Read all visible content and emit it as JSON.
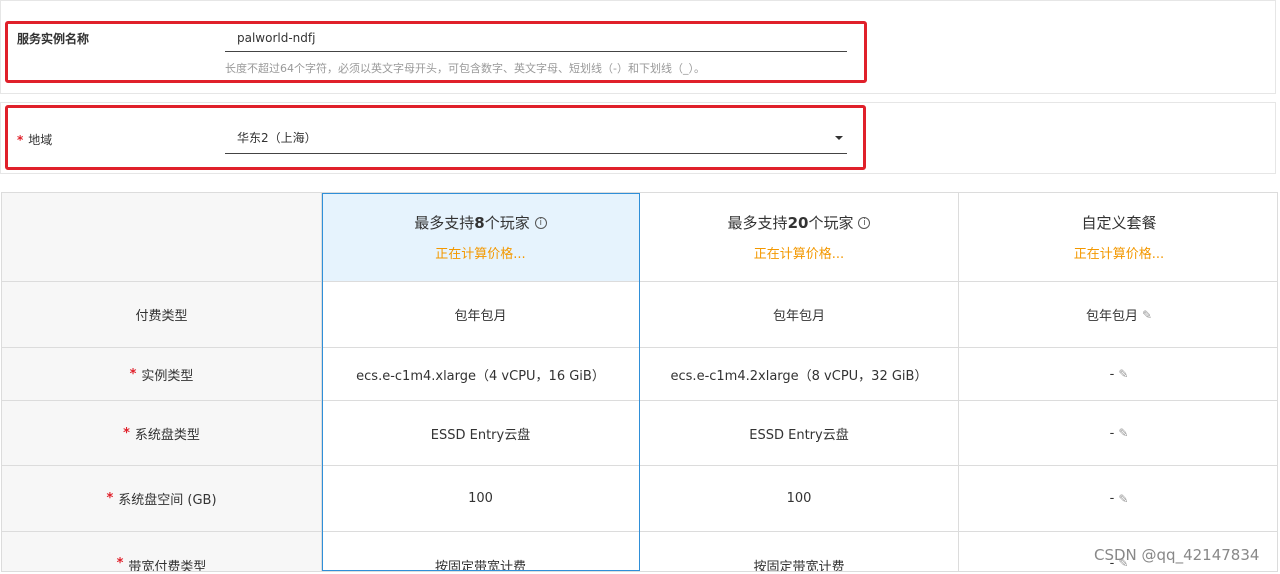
{
  "form": {
    "instance_name_label": "服务实例名称",
    "instance_name_value": "palworld-ndfj",
    "instance_name_hint": "长度不超过64个字符，必须以英文字母开头，可包含数字、英文字母、短划线（-）和下划线（_）。",
    "region_required": "*",
    "region_label": "地域",
    "region_value": "华东2（上海）"
  },
  "plans": [
    {
      "title_prefix": "最多支持",
      "title_number": "8",
      "title_suffix": "个玩家",
      "price": "正在计算价格...",
      "info_icon": "i"
    },
    {
      "title_prefix": "最多支持",
      "title_number": "20",
      "title_suffix": "个玩家",
      "price": "正在计算价格...",
      "info_icon": "i"
    },
    {
      "title": "自定义套餐",
      "price": "正在计算价格..."
    }
  ],
  "rows": [
    {
      "required": "",
      "label": "付费类型",
      "values": [
        "包年包月",
        "包年包月",
        "包年包月"
      ]
    },
    {
      "required": "*",
      "label": "实例类型",
      "values": [
        "ecs.e-c1m4.xlarge（4 vCPU，16 GiB）",
        "ecs.e-c1m4.2xlarge（8 vCPU，32 GiB）",
        "-"
      ]
    },
    {
      "required": "*",
      "label": "系统盘类型",
      "values": [
        "ESSD Entry云盘",
        "ESSD Entry云盘",
        "-"
      ]
    },
    {
      "required": "*",
      "label": "系统盘空间 (GB)",
      "values": [
        "100",
        "100",
        "-"
      ]
    },
    {
      "required": "*",
      "label": "带宽付费类型",
      "values": [
        "按固定带宽计费",
        "按固定带宽计费",
        "-"
      ]
    }
  ],
  "icons": {
    "pencil": "✎",
    "info": "info-icon",
    "caret": "chevron-down-icon"
  },
  "colors": {
    "highlight": "#e0202a",
    "price": "#f39800",
    "selected_bg": "#e6f3fd",
    "selected_border": "#2f8fd8"
  },
  "watermark": "CSDN @qq_42147834"
}
